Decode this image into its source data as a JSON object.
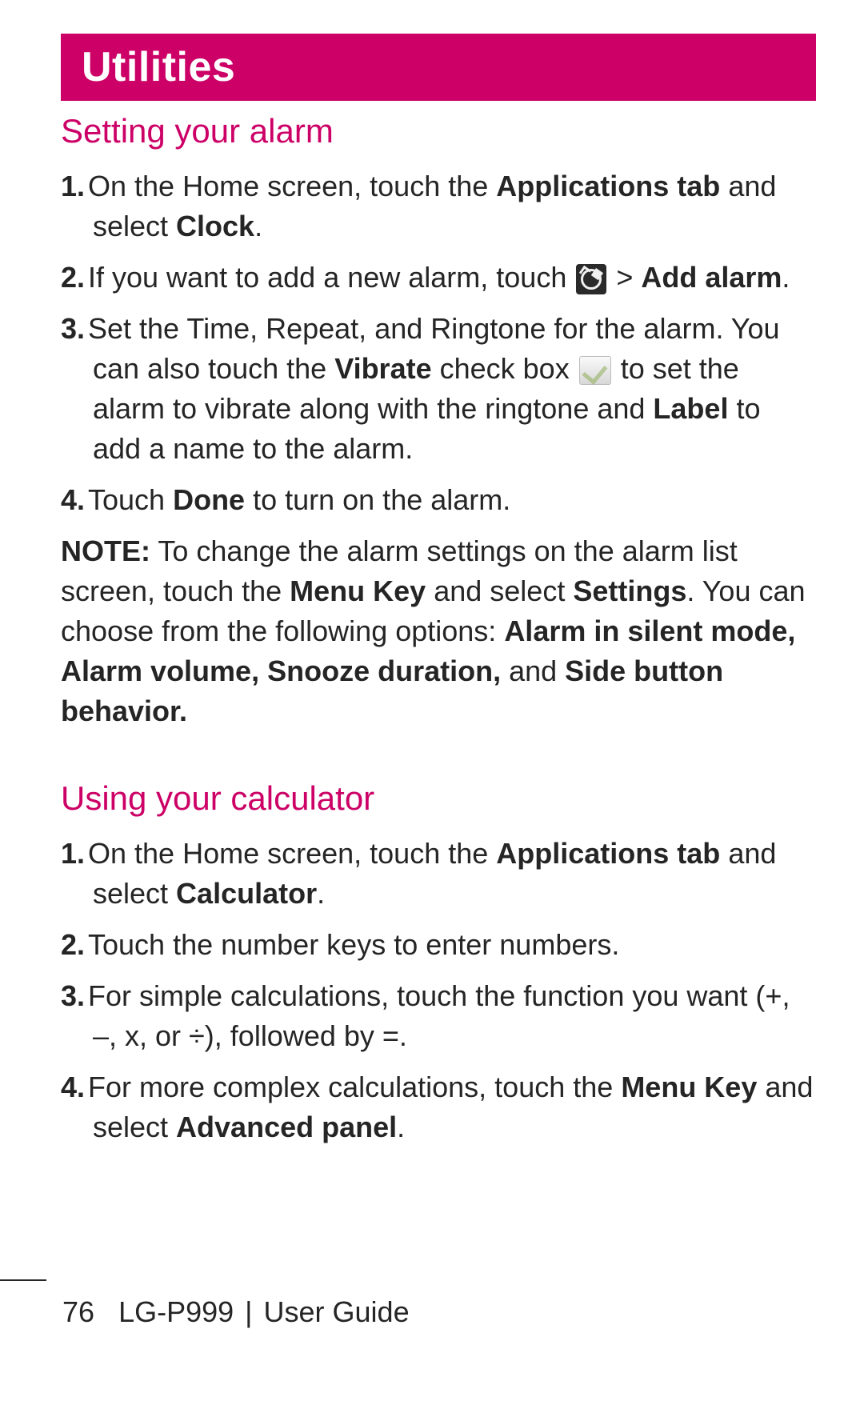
{
  "chapter_title": "Utilities",
  "section1": {
    "heading": "Setting your alarm",
    "steps": {
      "s1_a": "On the Home screen, touch the ",
      "s1_b": "Applications tab",
      "s1_c": " and select ",
      "s1_d": "Clock",
      "s1_e": ".",
      "s2_a": "If you want to add a new alarm, touch ",
      "s2_b": " > ",
      "s2_c": "Add alarm",
      "s2_d": ".",
      "s3_a": "Set the Time, Repeat, and Ringtone for the alarm. You can also touch the ",
      "s3_b": "Vibrate",
      "s3_c": " check box ",
      "s3_d": " to set the alarm to vibrate along with the ringtone and ",
      "s3_e": "Label",
      "s3_f": " to add a name to the alarm.",
      "s4_a": "Touch ",
      "s4_b": "Done",
      "s4_c": " to turn on the alarm."
    },
    "note": {
      "lead": "NOTE:",
      "a": " To change the alarm settings on the alarm list screen, touch the ",
      "b": "Menu Key",
      "c": " and select ",
      "d": "Settings",
      "e": ". You can choose from the following options: ",
      "f": "Alarm in silent mode, Alarm volume, Snooze duration,",
      "g": " and ",
      "h": "Side button behavior."
    }
  },
  "section2": {
    "heading": "Using your calculator",
    "steps": {
      "s1_a": "On the Home screen, touch the ",
      "s1_b": "Applications tab",
      "s1_c": " and select ",
      "s1_d": "Calculator",
      "s1_e": ".",
      "s2": "Touch the number keys to enter numbers.",
      "s3": "For simple calculations, touch the function you want (+, –, x, or ÷), followed by =.",
      "s4_a": "For more complex calculations, touch the ",
      "s4_b": "Menu Key",
      "s4_c": " and select ",
      "s4_d": "Advanced panel",
      "s4_e": "."
    }
  },
  "nums": {
    "n1": "1.",
    "n2": "2.",
    "n3": "3.",
    "n4": "4."
  },
  "footer": {
    "page_number": "76",
    "model": "LG-P999",
    "separator": "|",
    "doc": "User Guide"
  }
}
